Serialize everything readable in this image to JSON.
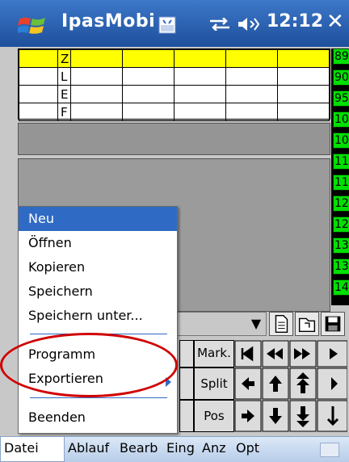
{
  "titlebar": {
    "title": "IpasMobi",
    "time": "12:12",
    "close_label": "✕"
  },
  "grid": {
    "rows": [
      {
        "c1": "Z",
        "highlight": true
      },
      {
        "c1": "L",
        "highlight": false
      },
      {
        "c1": "E",
        "highlight": false
      },
      {
        "c1": "F",
        "highlight": false
      }
    ]
  },
  "green_column": [
    "89",
    "90",
    "95",
    "10",
    "10",
    "11",
    "11",
    "12",
    "12",
    "13",
    "13",
    "14"
  ],
  "keypad": {
    "row1": [
      "Mark."
    ],
    "row2": [
      "Split"
    ],
    "row3": [
      "Pos"
    ]
  },
  "popup_menu": {
    "items": [
      {
        "label": "Neu",
        "selected": true
      },
      {
        "label": "Öffnen",
        "selected": false
      },
      {
        "label": "Kopieren",
        "selected": false
      },
      {
        "label": "Speichern",
        "selected": false
      },
      {
        "label": "Speichern unter...",
        "selected": false
      },
      {
        "label": "Programm",
        "selected": false
      },
      {
        "label": "Exportieren",
        "selected": false
      },
      {
        "label": "Beenden",
        "selected": false
      }
    ]
  },
  "menubar": {
    "items": [
      "Datei",
      "Ablauf",
      "Bearb",
      "Eing",
      "Anz",
      "Opt"
    ]
  },
  "colors": {
    "accent": "#2f6bc4",
    "highlight_row": "#ffff00",
    "green_cells": "#00e000",
    "annotation": "#d00000"
  }
}
